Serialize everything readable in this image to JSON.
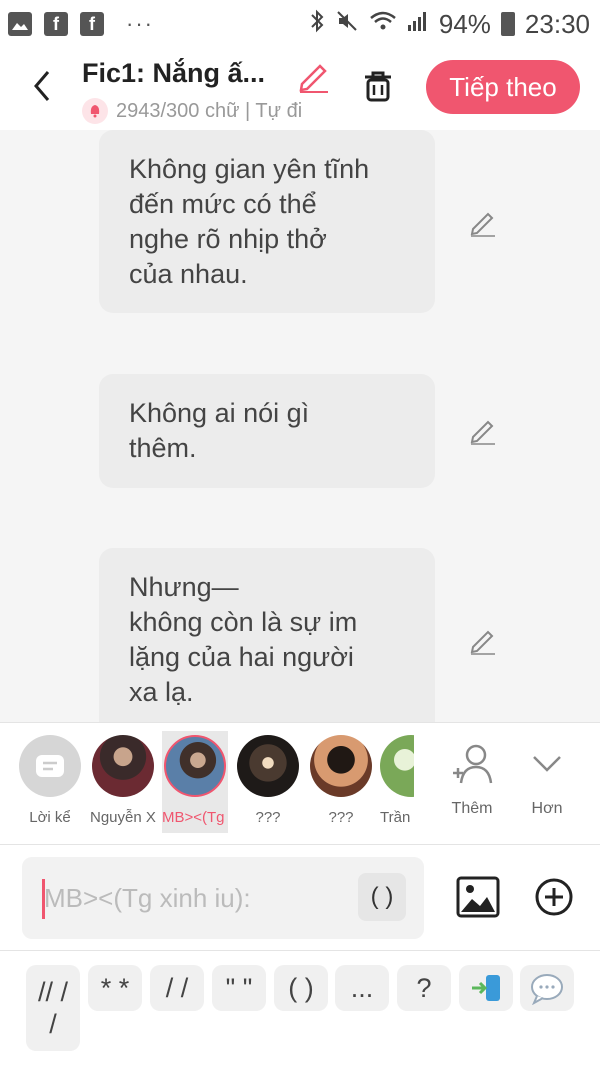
{
  "status": {
    "battery": "94%",
    "time": "23:30",
    "fb1": "f",
    "fb2": "f",
    "dots": "···"
  },
  "header": {
    "title": "Fic1: Nắng ấ...",
    "subtitle": "2943/300 chữ | Tự đi",
    "next_label": "Tiếp theo"
  },
  "messages": [
    {
      "text": "Không gian yên tĩnh\nđến mức có thể\nnghe rõ nhịp thở\ncủa nhau."
    },
    {
      "text": "Không ai nói gì\nthêm."
    },
    {
      "text": "Nhưng—\nkhông còn là sự im\nlặng của hai người\nxa lạ."
    }
  ],
  "characters": [
    {
      "label": "Lời kể"
    },
    {
      "label": "Nguyễn X..."
    },
    {
      "label": "MB><(Tg x..."
    },
    {
      "label": "???"
    },
    {
      "label": "???"
    },
    {
      "label": "Trần T..."
    }
  ],
  "actions": {
    "more_label": "Thêm",
    "expand_label": "Hơn"
  },
  "input": {
    "placeholder": "MB><(Tg xinh iu):",
    "paren_label": "( )"
  },
  "quick_buttons": [
    "// /\n/",
    "* *",
    "/ /",
    "\" \"",
    "( )",
    "...",
    "?"
  ],
  "colors": {
    "accent": "#f0566f",
    "bubble": "#ececec",
    "background": "#f5f5f5"
  }
}
